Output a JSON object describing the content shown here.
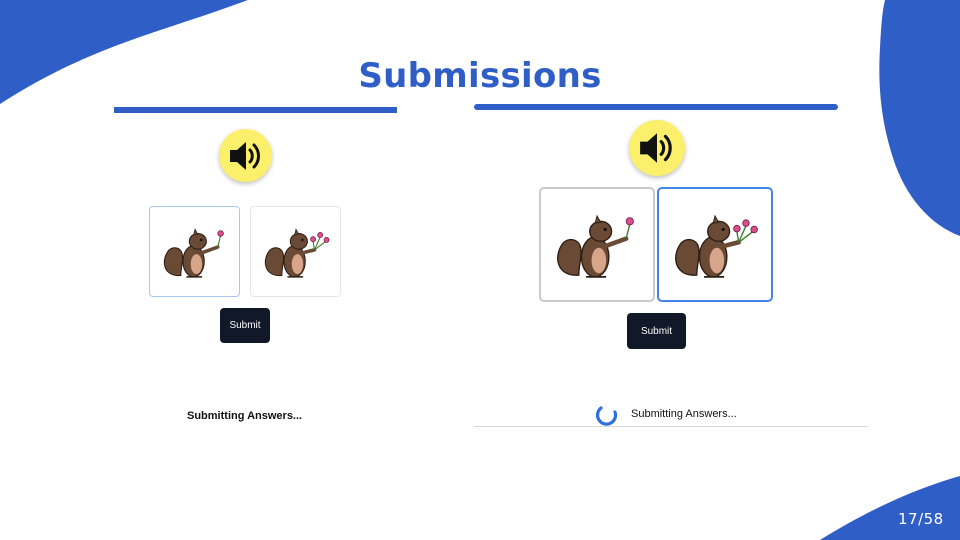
{
  "slide": {
    "title": "Submissions",
    "page_number": "17/58",
    "accent_color": "#2f5fc6"
  },
  "left_panel": {
    "speaker_icon": "speaker-volume-icon",
    "options": [
      {
        "image": "squirrel-one-flower",
        "selected": false
      },
      {
        "image": "squirrel-three-flowers",
        "selected": false
      }
    ],
    "submit_label": "Submit",
    "status_text": "Submitting Answers..."
  },
  "right_panel": {
    "speaker_icon": "speaker-volume-icon",
    "options": [
      {
        "image": "squirrel-one-flower",
        "selected": false
      },
      {
        "image": "squirrel-three-flowers",
        "selected": true
      }
    ],
    "submit_label": "Submit",
    "status_text": "Submitting Answers...",
    "spinner_icon": "loading-spinner-icon"
  }
}
